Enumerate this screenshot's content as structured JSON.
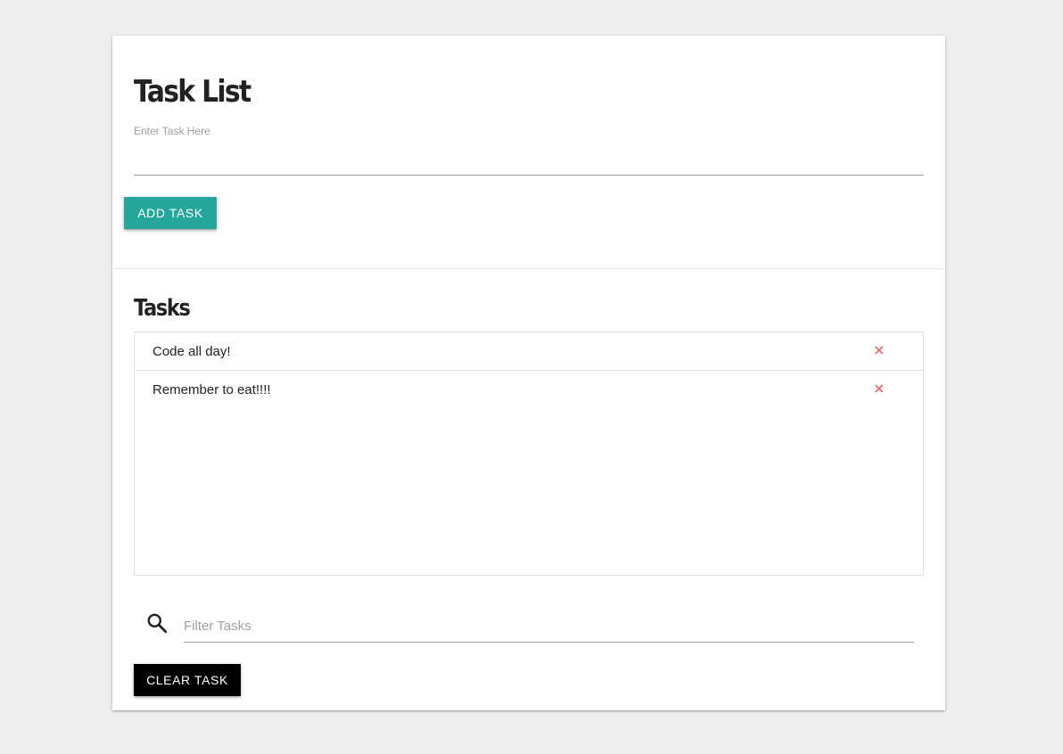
{
  "header": {
    "title": "Task List",
    "input_label": "Enter Task Here",
    "input_value": "",
    "add_button_label": "Add Task"
  },
  "tasks_section": {
    "title": "Tasks",
    "items": [
      {
        "text": "Code all day!",
        "delete_icon": "×"
      },
      {
        "text": "Remember to eat!!!!",
        "delete_icon": "×"
      }
    ]
  },
  "filter": {
    "icon": "search-icon",
    "placeholder": "Filter Tasks",
    "value": ""
  },
  "clear_button_label": "Clear Task",
  "colors": {
    "accent": "#26a69a",
    "delete": "#e57373",
    "clear_button": "#000000",
    "background": "#eeeeee"
  }
}
